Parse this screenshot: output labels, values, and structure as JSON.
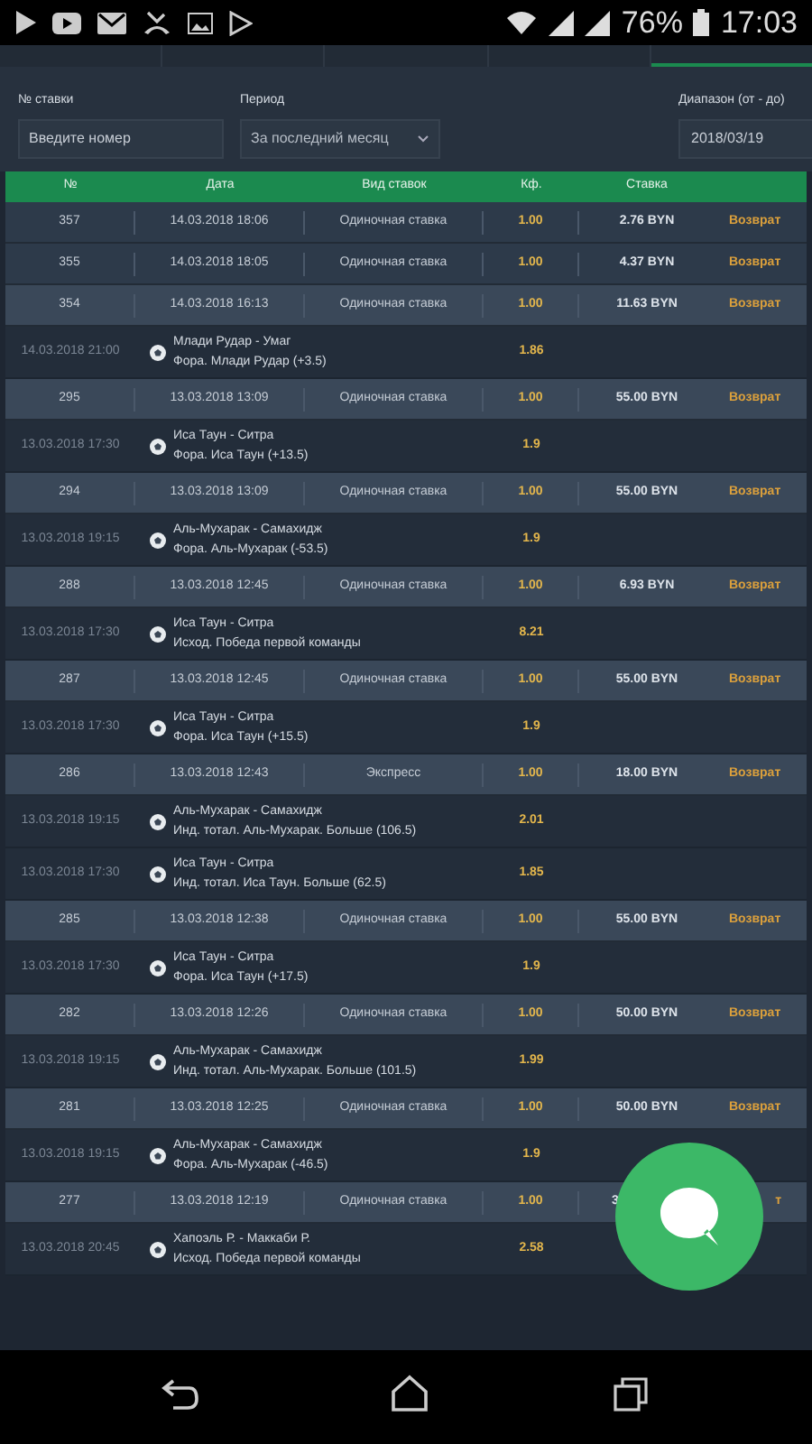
{
  "status_bar": {
    "battery": "76%",
    "time": "17:03"
  },
  "tabs": [
    {
      "selected": false
    },
    {
      "selected": false
    },
    {
      "selected": false
    },
    {
      "selected": false
    },
    {
      "selected": true
    }
  ],
  "filters": {
    "bet_number": {
      "label": "№ ставки",
      "placeholder": "Введите номер"
    },
    "period": {
      "label": "Период",
      "value": "За последний месяц"
    },
    "range": {
      "label": "Диапазон (от - до)",
      "value": "2018/03/19"
    }
  },
  "table": {
    "columns": [
      "№",
      "Дата",
      "Вид ставок",
      "Кф.",
      "Ставка"
    ],
    "rows": [
      {
        "kind": "bet",
        "partial": false,
        "number": "357",
        "date": "14.03.2018 18:06",
        "type": "Одиночная ставка",
        "coef": "1.00",
        "stake": "2.76 BYN",
        "action": "Возврат"
      },
      {
        "kind": "bet",
        "partial": false,
        "number": "355",
        "date": "14.03.2018 18:05",
        "type": "Одиночная ставка",
        "coef": "1.00",
        "stake": "4.37 BYN",
        "action": "Возврат"
      },
      {
        "kind": "bet",
        "partial": false,
        "number": "354",
        "date": "14.03.2018 16:13",
        "type": "Одиночная ставка",
        "coef": "1.00",
        "stake": "11.63 BYN",
        "action": "Возврат"
      },
      {
        "kind": "event",
        "date": "14.03.2018 21:00",
        "match": "Млади Рудар - Умаг",
        "market": "Фора. Млади Рудар (+3.5)",
        "coef": "1.86"
      },
      {
        "kind": "bet",
        "partial": false,
        "number": "295",
        "date": "13.03.2018 13:09",
        "type": "Одиночная ставка",
        "coef": "1.00",
        "stake": "55.00 BYN",
        "action": "Возврат"
      },
      {
        "kind": "event",
        "date": "13.03.2018 17:30",
        "match": "Иса Таун - Ситра",
        "market": "Фора. Иса Таун (+13.5)",
        "coef": "1.9"
      },
      {
        "kind": "bet",
        "partial": false,
        "number": "294",
        "date": "13.03.2018 13:09",
        "type": "Одиночная ставка",
        "coef": "1.00",
        "stake": "55.00 BYN",
        "action": "Возврат"
      },
      {
        "kind": "event",
        "date": "13.03.2018 19:15",
        "match": "Аль-Мухарак - Самахидж",
        "market": "Фора. Аль-Мухарак (-53.5)",
        "coef": "1.9"
      },
      {
        "kind": "bet",
        "partial": false,
        "number": "288",
        "date": "13.03.2018 12:45",
        "type": "Одиночная ставка",
        "coef": "1.00",
        "stake": "6.93 BYN",
        "action": "Возврат"
      },
      {
        "kind": "event",
        "date": "13.03.2018 17:30",
        "match": "Иса Таун - Ситра",
        "market": "Исход. Победа первой команды",
        "coef": "8.21"
      },
      {
        "kind": "bet",
        "partial": false,
        "number": "287",
        "date": "13.03.2018 12:45",
        "type": "Одиночная ставка",
        "coef": "1.00",
        "stake": "55.00 BYN",
        "action": "Возврат"
      },
      {
        "kind": "event",
        "date": "13.03.2018 17:30",
        "match": "Иса Таун - Ситра",
        "market": "Фора. Иса Таун (+15.5)",
        "coef": "1.9"
      },
      {
        "kind": "bet",
        "partial": false,
        "number": "286",
        "date": "13.03.2018 12:43",
        "type": "Экспресс",
        "coef": "1.00",
        "stake": "18.00 BYN",
        "action": "Возврат"
      },
      {
        "kind": "event",
        "date": "13.03.2018 19:15",
        "match": "Аль-Мухарак - Самахидж",
        "market": "Инд. тотал. Аль-Мухарак. Больше (106.5)",
        "coef": "2.01"
      },
      {
        "kind": "event",
        "date": "13.03.2018 17:30",
        "match": "Иса Таун - Ситра",
        "market": "Инд. тотал. Иса Таун. Больше (62.5)",
        "coef": "1.85"
      },
      {
        "kind": "bet",
        "partial": false,
        "number": "285",
        "date": "13.03.2018 12:38",
        "type": "Одиночная ставка",
        "coef": "1.00",
        "stake": "55.00 BYN",
        "action": "Возврат"
      },
      {
        "kind": "event",
        "date": "13.03.2018 17:30",
        "match": "Иса Таун - Ситра",
        "market": "Фора. Иса Таун (+17.5)",
        "coef": "1.9"
      },
      {
        "kind": "bet",
        "partial": false,
        "number": "282",
        "date": "13.03.2018 12:26",
        "type": "Одиночная ставка",
        "coef": "1.00",
        "stake": "50.00 BYN",
        "action": "Возврат"
      },
      {
        "kind": "event",
        "date": "13.03.2018 19:15",
        "match": "Аль-Мухарак - Самахидж",
        "market": "Инд. тотал. Аль-Мухарак. Больше (101.5)",
        "coef": "1.99"
      },
      {
        "kind": "bet",
        "partial": false,
        "number": "281",
        "date": "13.03.2018 12:25",
        "type": "Одиночная ставка",
        "coef": "1.00",
        "stake": "50.00 BYN",
        "action": "Возврат"
      },
      {
        "kind": "event",
        "date": "13.03.2018 19:15",
        "match": "Аль-Мухарак - Самахидж",
        "market": "Фора. Аль-Мухарак (-46.5)",
        "coef": "1.9"
      },
      {
        "kind": "bet",
        "partial": true,
        "number": "277",
        "date": "13.03.2018 12:19",
        "type": "Одиночная ставка",
        "coef": "1.00",
        "stake": "3",
        "action": "т"
      },
      {
        "kind": "event",
        "date": "13.03.2018 20:45",
        "match": "Хапоэль Р. - Маккаби Р.",
        "market": "Исход. Победа первой команды",
        "coef": "2.58"
      }
    ]
  }
}
